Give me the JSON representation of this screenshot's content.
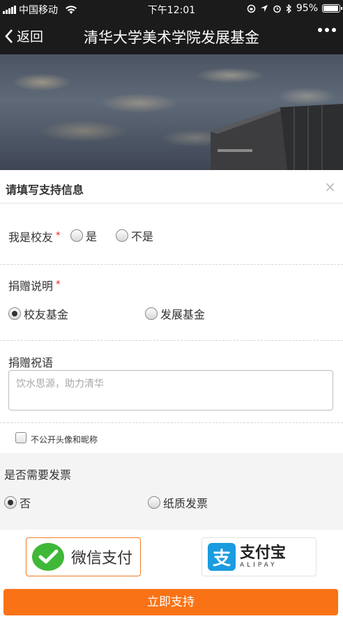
{
  "status_bar": {
    "carrier": "中国移动",
    "time": "下午12:01",
    "battery": "95%",
    "battery_level": 0.95
  },
  "nav": {
    "back_label": "返回",
    "title": "清华大学美术学院发展基金"
  },
  "modal": {
    "title": "请填写支持信息",
    "close": "×"
  },
  "alumni": {
    "label": "我是校友",
    "required_mark": "*",
    "options": [
      "是",
      "不是"
    ],
    "selected": null
  },
  "donation_desc": {
    "label": "捐赠说明",
    "required_mark": "*",
    "options": [
      "校友基金",
      "发展基金"
    ],
    "selected": "校友基金"
  },
  "message": {
    "label": "捐赠祝语",
    "placeholder": "饮水思源，助力清华"
  },
  "anonymous": {
    "label": "不公开头像和昵称",
    "checked": false
  },
  "invoice": {
    "label": "是否需要发票",
    "options": [
      "否",
      "纸质发票"
    ],
    "selected": "否"
  },
  "payment": {
    "wechat_label": "微信支付",
    "alipay_label": "支付宝",
    "alipay_en": "ALIPAY",
    "alipay_glyph": "支",
    "selected": "wechat"
  },
  "submit_label": "立即支持",
  "colors": {
    "accent": "#f97316",
    "wechat": "#3fb837",
    "alipay": "#1a9cdf",
    "dark_bar": "#1b1b1b"
  }
}
